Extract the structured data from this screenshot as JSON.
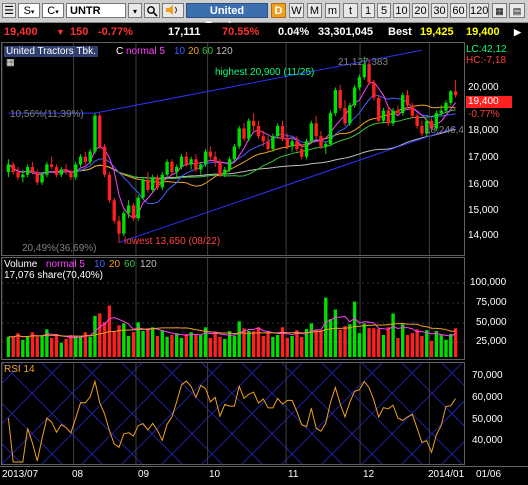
{
  "toolbar": {
    "market_letter": "S",
    "type_letter": "C",
    "ticker": "UNTR",
    "company": "United Tractors",
    "periods": [
      "D",
      "W",
      "M",
      "m",
      "t",
      "1",
      "5",
      "10",
      "20",
      "30",
      "60",
      "120"
    ],
    "active_period": "D"
  },
  "quote": {
    "last": "19,400",
    "change": "150",
    "change_pct": "-0.77%",
    "volume_small": "17,111",
    "ratio": "70.55%",
    "ratio2": "0.04%",
    "volume": "33,301,045",
    "best_label": "Best",
    "bid": "19,425",
    "ask": "19,400"
  },
  "price_pane": {
    "title": "United Tractors Tbk.",
    "indicator": "C",
    "ma_label": "normal 5",
    "ma_periods": [
      "10",
      "20",
      "60",
      "120"
    ],
    "highest": "highest 20,900 (11/25)",
    "lowest": "lowest 13,650 (08/22)",
    "top_right_value": "21,127,383",
    "pct_left_top": "10,56%(11,39%)",
    "pct_left_bottom": "20,49%(36,69%)",
    "mid_right_value": "18,246,4",
    "lc": "LC:42,12",
    "hc": "HC:-7,18",
    "current_price": "19,400",
    "current_pct": "-0.77%",
    "ticks": [
      "20,000",
      "19,000",
      "18,000",
      "17,000",
      "16,000",
      "15,000",
      "14,000"
    ],
    "colors": {
      "up": "#00e000",
      "down": "#ff2020",
      "ma5": "#ff40ff",
      "ma10": "#4060ff",
      "ma20": "#f0a020",
      "ma60": "#40c040",
      "ma120": "#c0c0c0",
      "trend": "#3030ff"
    }
  },
  "volume_pane": {
    "title": "Volume",
    "ma_label": "normal 5",
    "ma_periods": [
      "10",
      "20",
      "60",
      "120"
    ],
    "current": "17,076 share(70,40%)",
    "ticks": [
      "100,000",
      "75,000",
      "50,000",
      "25,000"
    ]
  },
  "rsi_pane": {
    "title": "RSI 14",
    "ticks": [
      "70,000",
      "60,000",
      "50,000",
      "40,000"
    ]
  },
  "dates": [
    "2013/07",
    "08",
    "09",
    "10",
    "11",
    "12",
    "2014/01",
    "01/06"
  ],
  "chart_data": {
    "type": "candlestick",
    "title": "United Tractors Tbk.",
    "ylim": [
      13400,
      21200
    ],
    "candles": [
      [
        16400,
        16900,
        16200,
        16700
      ],
      [
        16700,
        16800,
        16300,
        16400
      ],
      [
        16400,
        16600,
        16100,
        16200
      ],
      [
        16200,
        16500,
        16000,
        16300
      ],
      [
        16300,
        16700,
        16200,
        16600
      ],
      [
        16600,
        16800,
        16300,
        16400
      ],
      [
        16400,
        16500,
        15900,
        16000
      ],
      [
        16000,
        16400,
        15900,
        16300
      ],
      [
        16300,
        16800,
        16200,
        16700
      ],
      [
        16700,
        17000,
        16500,
        16600
      ],
      [
        16600,
        16700,
        16200,
        16300
      ],
      [
        16300,
        16600,
        16200,
        16500
      ],
      [
        16500,
        16700,
        16300,
        16400
      ],
      [
        16400,
        16500,
        16100,
        16200
      ],
      [
        16200,
        16800,
        16100,
        16700
      ],
      [
        16700,
        17100,
        16600,
        17000
      ],
      [
        17000,
        17200,
        16700,
        16800
      ],
      [
        16800,
        17300,
        16700,
        17200
      ],
      [
        17200,
        18700,
        17100,
        18600
      ],
      [
        18600,
        18700,
        17300,
        17400
      ],
      [
        17400,
        17500,
        16200,
        16300
      ],
      [
        16300,
        16400,
        15200,
        15300
      ],
      [
        15300,
        15400,
        14400,
        14500
      ],
      [
        14500,
        14700,
        13650,
        14000
      ],
      [
        14000,
        14900,
        13900,
        14800
      ],
      [
        14800,
        15300,
        14600,
        15100
      ],
      [
        15100,
        15200,
        14500,
        14600
      ],
      [
        14600,
        15500,
        14500,
        15400
      ],
      [
        15400,
        16200,
        15300,
        16100
      ],
      [
        16100,
        16400,
        15600,
        15700
      ],
      [
        15700,
        16300,
        15600,
        16200
      ],
      [
        16200,
        16300,
        15700,
        15800
      ],
      [
        15800,
        16400,
        15700,
        16300
      ],
      [
        16300,
        16900,
        16200,
        16800
      ],
      [
        16800,
        16900,
        16300,
        16400
      ],
      [
        16400,
        16700,
        16200,
        16600
      ],
      [
        16600,
        17100,
        16500,
        17000
      ],
      [
        17000,
        17200,
        16600,
        16700
      ],
      [
        16700,
        17000,
        16500,
        16900
      ],
      [
        16900,
        17100,
        16400,
        16500
      ],
      [
        16500,
        16800,
        16300,
        16700
      ],
      [
        16700,
        17300,
        16600,
        17200
      ],
      [
        17200,
        17400,
        16900,
        17000
      ],
      [
        17000,
        17200,
        16600,
        16800
      ],
      [
        16800,
        16900,
        16200,
        16300
      ],
      [
        16300,
        16600,
        16200,
        16500
      ],
      [
        16500,
        17000,
        16400,
        16900
      ],
      [
        16900,
        17500,
        16800,
        17400
      ],
      [
        17400,
        18200,
        17300,
        18100
      ],
      [
        18100,
        18300,
        17600,
        17700
      ],
      [
        17700,
        18500,
        17600,
        18400
      ],
      [
        18400,
        18700,
        18000,
        18200
      ],
      [
        18200,
        18400,
        17700,
        17800
      ],
      [
        17800,
        18000,
        17400,
        17600
      ],
      [
        17600,
        17800,
        17200,
        17300
      ],
      [
        17300,
        17900,
        17200,
        17800
      ],
      [
        17800,
        18300,
        17700,
        18200
      ],
      [
        18200,
        18400,
        17600,
        17700
      ],
      [
        17700,
        17900,
        17300,
        17400
      ],
      [
        17400,
        17700,
        17200,
        17600
      ],
      [
        17600,
        17800,
        17200,
        17300
      ],
      [
        17300,
        17500,
        16900,
        17000
      ],
      [
        17000,
        17700,
        16900,
        17600
      ],
      [
        17600,
        18400,
        17500,
        18300
      ],
      [
        18300,
        18600,
        17700,
        17800
      ],
      [
        17800,
        18000,
        17300,
        17400
      ],
      [
        17400,
        17600,
        17100,
        17500
      ],
      [
        17500,
        18800,
        17400,
        18700
      ],
      [
        18700,
        19700,
        18600,
        19600
      ],
      [
        19600,
        19800,
        18800,
        18900
      ],
      [
        18900,
        19200,
        18200,
        18300
      ],
      [
        18300,
        19100,
        18200,
        19000
      ],
      [
        19000,
        19800,
        18900,
        19700
      ],
      [
        19700,
        20200,
        19600,
        20100
      ],
      [
        20100,
        20900,
        20000,
        20600
      ],
      [
        20600,
        20800,
        19800,
        19900
      ],
      [
        19900,
        20000,
        19200,
        19300
      ],
      [
        19300,
        19400,
        18300,
        18400
      ],
      [
        18400,
        18900,
        18300,
        18800
      ],
      [
        18800,
        19000,
        18200,
        18300
      ],
      [
        18300,
        18900,
        18200,
        18800
      ],
      [
        18800,
        19000,
        18600,
        18700
      ],
      [
        18700,
        19500,
        18600,
        19400
      ],
      [
        19400,
        19600,
        18900,
        19000
      ],
      [
        19000,
        19100,
        18500,
        18600
      ],
      [
        18600,
        18700,
        18100,
        18200
      ],
      [
        18200,
        18400,
        17800,
        17900
      ],
      [
        17900,
        18500,
        17800,
        18400
      ],
      [
        18400,
        18500,
        18000,
        18100
      ],
      [
        18100,
        18800,
        18000,
        18700
      ],
      [
        18700,
        19000,
        18600,
        18800
      ],
      [
        18800,
        19200,
        18700,
        19100
      ],
      [
        19100,
        19600,
        19000,
        19550
      ],
      [
        19550,
        20000,
        19300,
        19400
      ]
    ]
  }
}
